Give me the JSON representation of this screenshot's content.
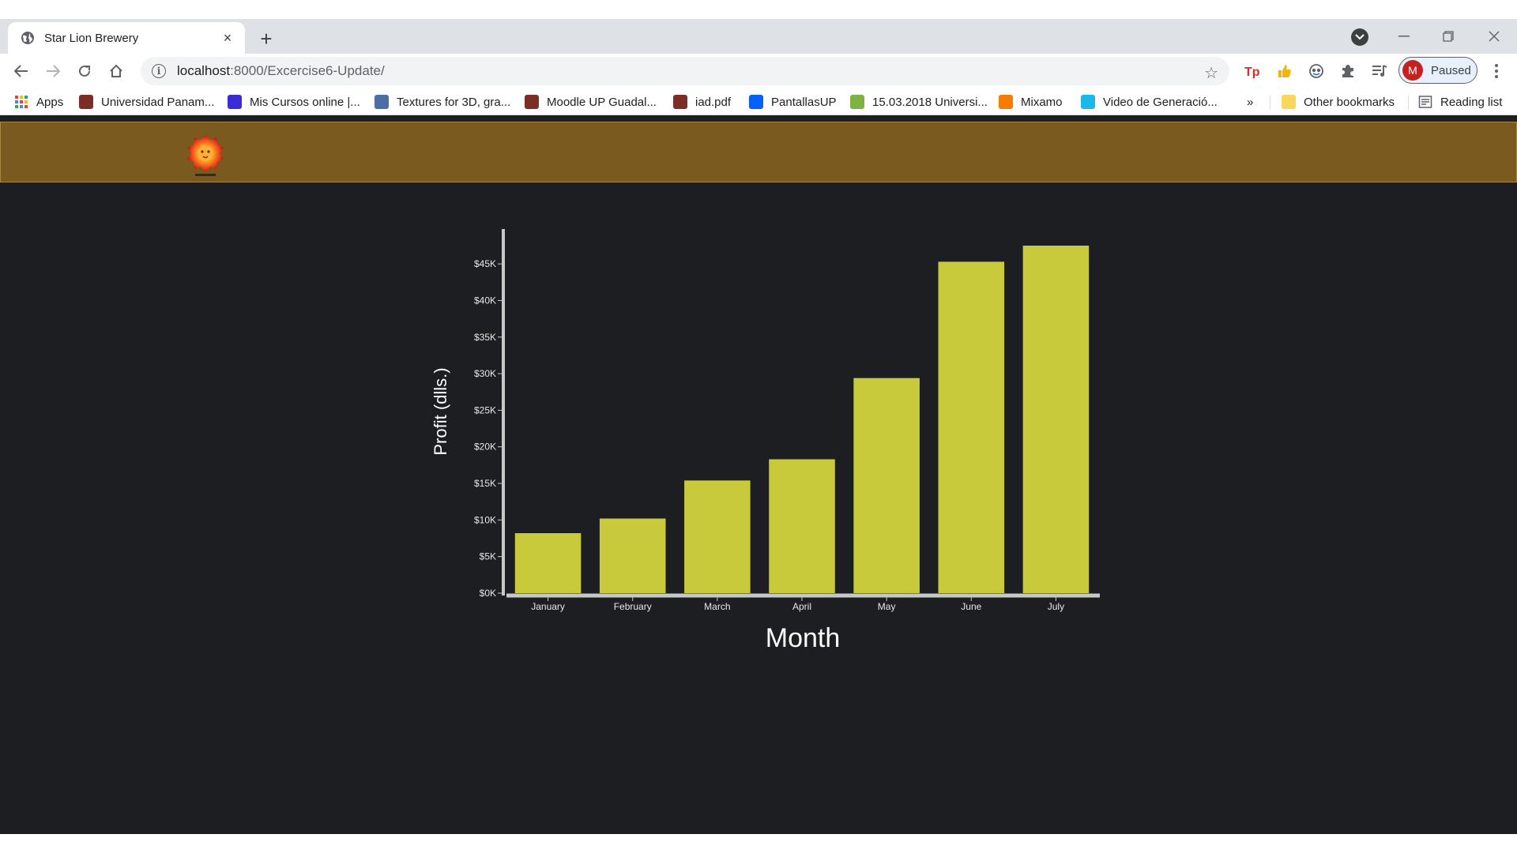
{
  "browser": {
    "tab_title": "Star Lion Brewery",
    "tab_close": "×",
    "new_tab": "+",
    "url_host": "localhost",
    "url_path": ":8000/Excercise6-Update/",
    "profile_initial": "M",
    "profile_status": "Paused"
  },
  "bookmarks": {
    "items": [
      {
        "label": "Apps",
        "icon": "apps-grid-icon",
        "color": "#4285f4"
      },
      {
        "label": "Universidad Panam...",
        "icon": "shield-crest-icon",
        "color": "#7b2d26"
      },
      {
        "label": "Mis Cursos online |...",
        "icon": "course-logo-icon",
        "color": "#3b2bd6"
      },
      {
        "label": "Textures for 3D, gra...",
        "icon": "cube-icon",
        "color": "#4a6fa5"
      },
      {
        "label": "Moodle UP Guadal...",
        "icon": "shield-crest-icon",
        "color": "#7b2d26"
      },
      {
        "label": "iad.pdf",
        "icon": "shield-crest-icon",
        "color": "#7b2d26"
      },
      {
        "label": "PantallasUP",
        "icon": "dropbox-icon",
        "color": "#0061fe"
      },
      {
        "label": "15.03.2018 Universi...",
        "icon": "smile-icon",
        "color": "#7cb342"
      },
      {
        "label": "Mixamo",
        "icon": "mixamo-icon",
        "color": "#f57c00"
      },
      {
        "label": "Video de Generació...",
        "icon": "vimeo-icon",
        "color": "#1ab7ea"
      }
    ],
    "overflow": "»",
    "other_bookmarks": "Other bookmarks",
    "reading_list": "Reading list"
  },
  "chart_data": {
    "type": "bar",
    "categories": [
      "January",
      "February",
      "March",
      "April",
      "May",
      "June",
      "July"
    ],
    "values": [
      8200,
      10200,
      15400,
      18300,
      29400,
      45300,
      47500
    ],
    "xlabel": "Month",
    "ylabel": "Profit (dlls.)",
    "yticks": [
      "$0K",
      "$5K",
      "$10K",
      "$15K",
      "$20K",
      "$25K",
      "$30K",
      "$35K",
      "$40K",
      "$45K"
    ],
    "ytick_values": [
      0,
      5000,
      10000,
      15000,
      20000,
      25000,
      30000,
      35000,
      40000,
      45000
    ],
    "ylim": [
      0,
      47500
    ],
    "bar_color": "#c8c93b",
    "axis_color": "#c8c8c8",
    "grid": false
  }
}
